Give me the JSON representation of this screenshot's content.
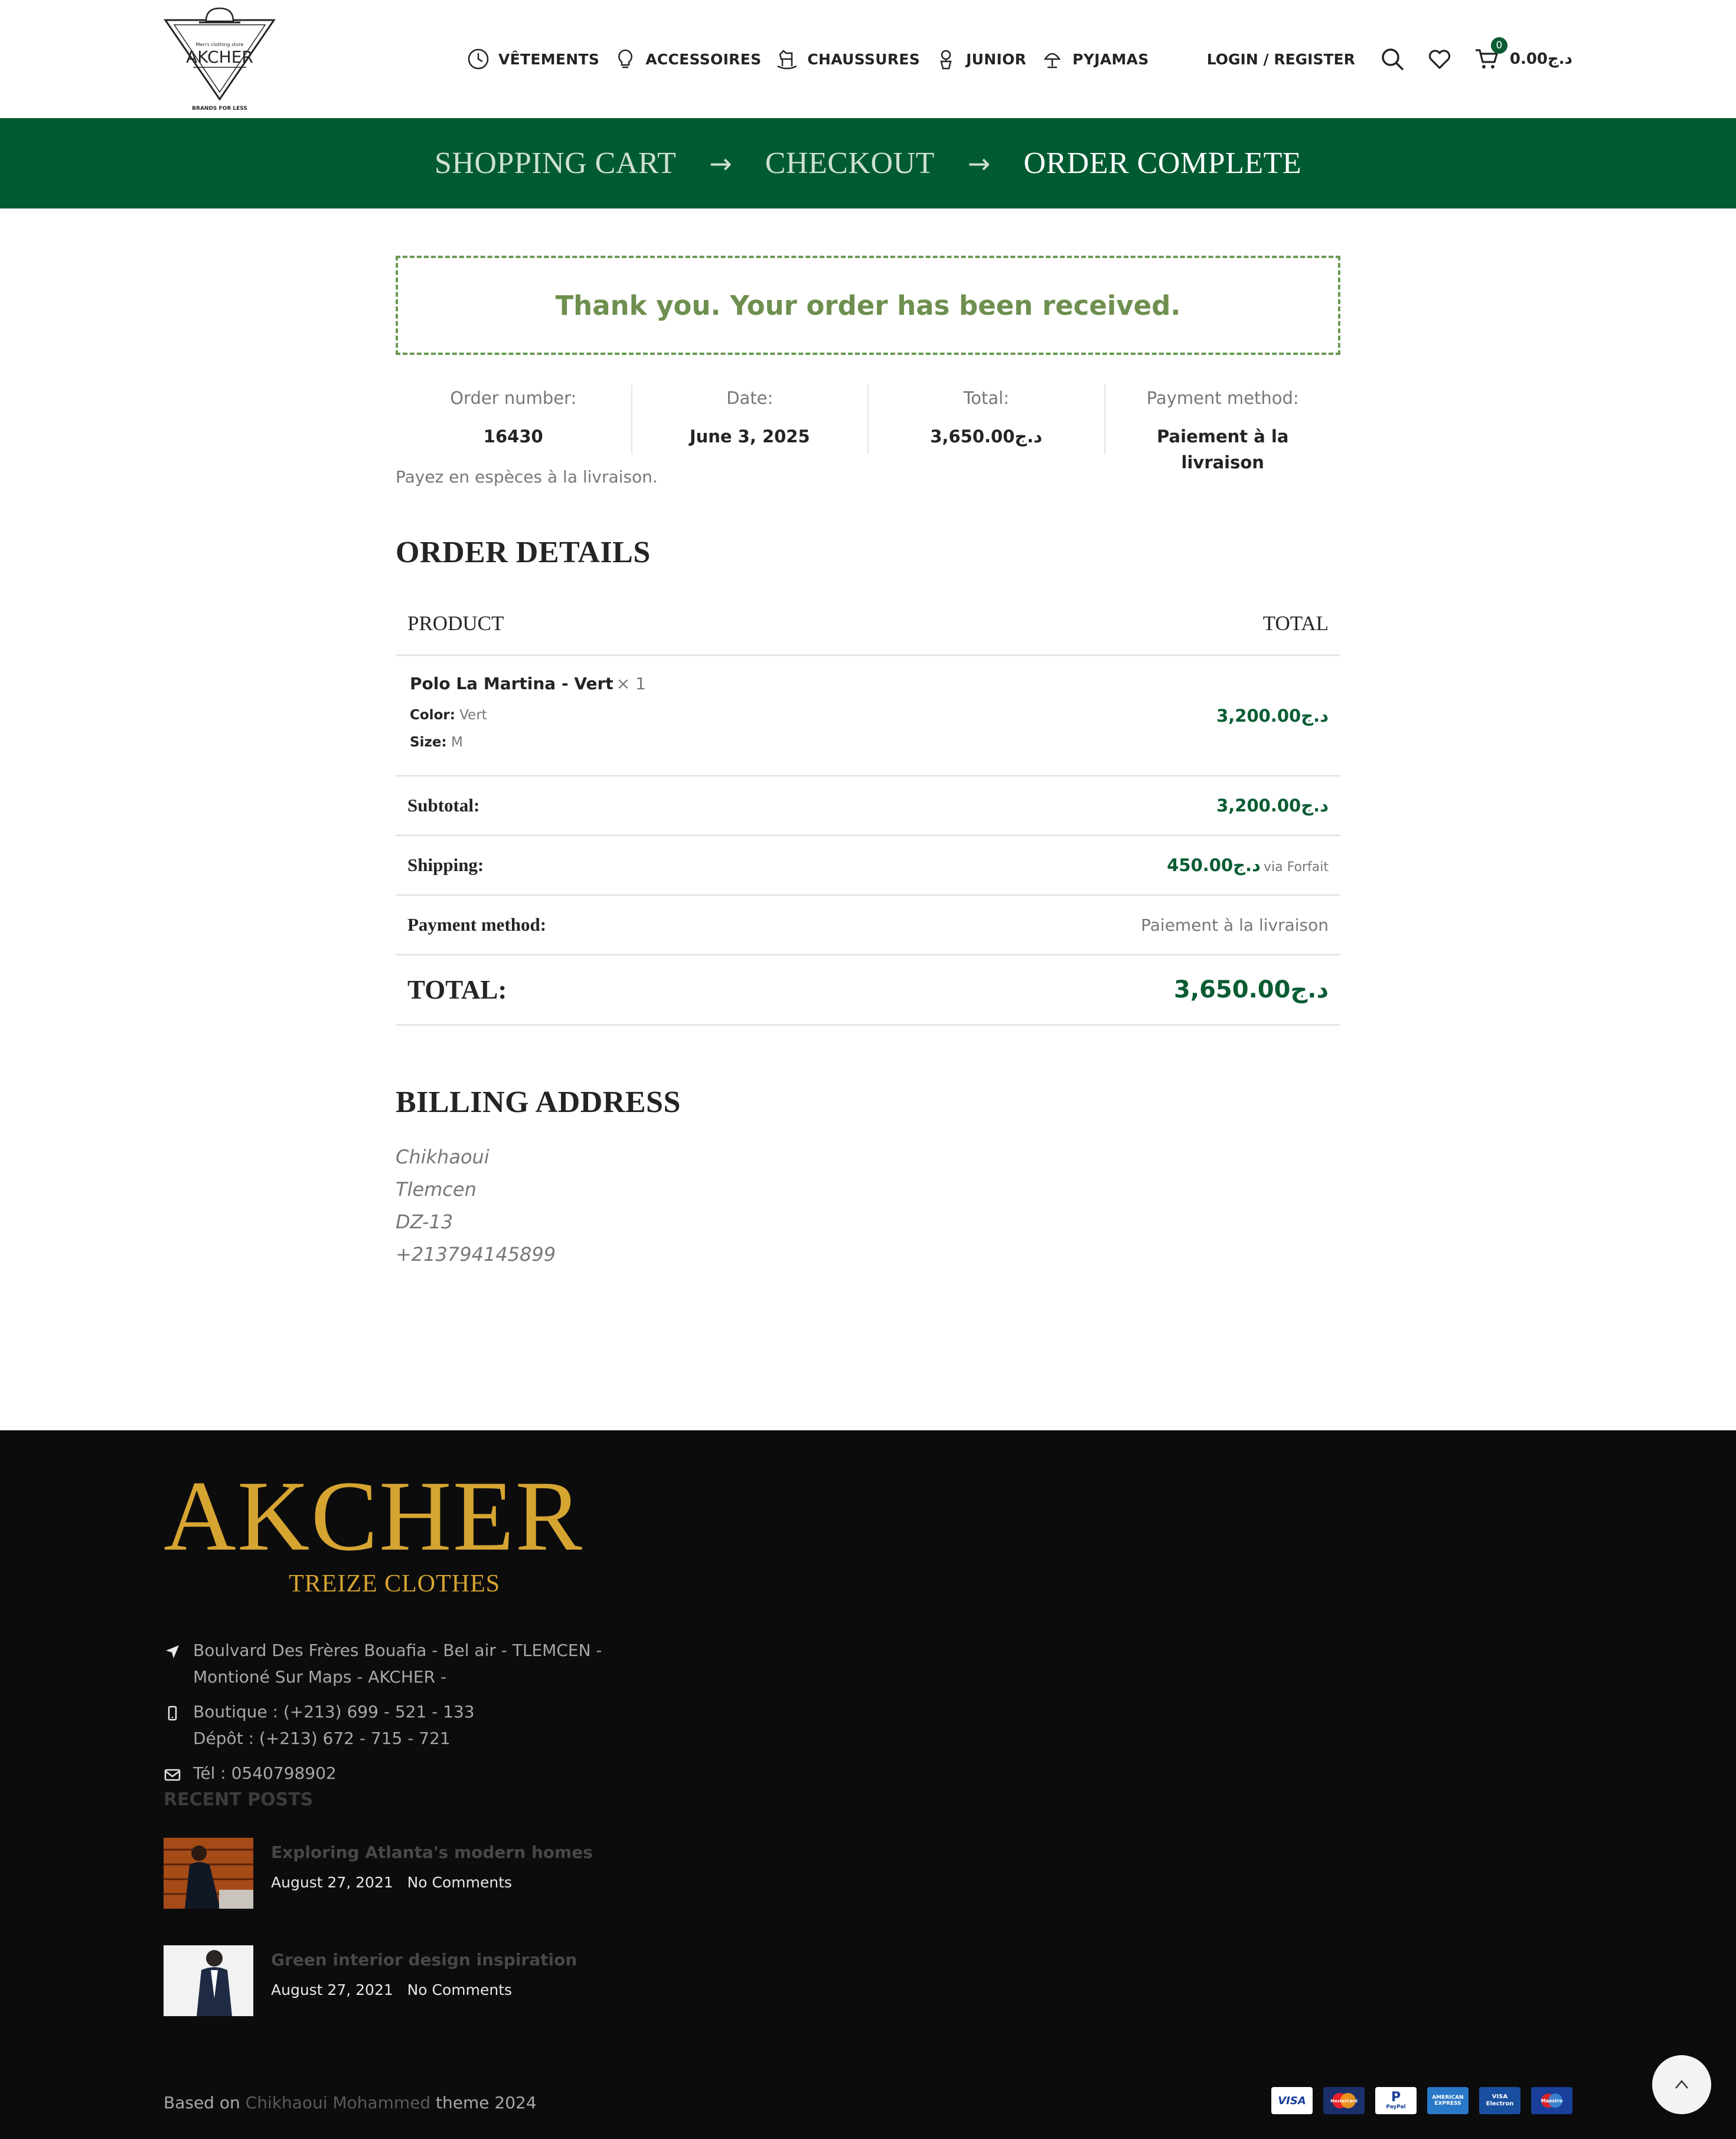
{
  "header": {
    "logo": {
      "tagline": "Men's clothing store",
      "name": "AKCHER",
      "subtitle": "BRANDS FOR LESS"
    },
    "nav": [
      {
        "label": "VÊTEMENTS",
        "icon": "clock-icon"
      },
      {
        "label": "ACCESSOIRES",
        "icon": "lightbulb-icon"
      },
      {
        "label": "CHAUSSURES",
        "icon": "rocking-horse-icon"
      },
      {
        "label": "JUNIOR",
        "icon": "plant-icon"
      },
      {
        "label": "PYJAMAS",
        "icon": "lamp-icon"
      }
    ],
    "login_label": "LOGIN / REGISTER",
    "cart_count": "0",
    "cart_total": "0.00د.ج"
  },
  "steps": {
    "cart": "SHOPPING CART",
    "checkout": "CHECKOUT",
    "complete": "ORDER COMPLETE",
    "arrow": "→"
  },
  "notice": "Thank you. Your order has been received.",
  "overview": [
    {
      "label": "Order number:",
      "value": "16430"
    },
    {
      "label": "Date:",
      "value": "June 3, 2025"
    },
    {
      "label": "Total:",
      "value": "3,650.00د.ج"
    },
    {
      "label": "Payment method:",
      "value": "Paiement à la livraison"
    }
  ],
  "payment_note": "Payez en espèces à la livraison.",
  "order_details": {
    "title": "ORDER DETAILS",
    "col_product": "PRODUCT",
    "col_total": "TOTAL",
    "item": {
      "name": "Polo La Martina - Vert",
      "qty": "× 1",
      "color_label": "Color:",
      "color": "Vert",
      "size_label": "Size:",
      "size": "M",
      "total": "3,200.00د.ج"
    },
    "subtotal_label": "Subtotal:",
    "subtotal": "3,200.00د.ج",
    "shipping_label": "Shipping:",
    "shipping": "450.00د.ج",
    "shipping_via": "via Forfait",
    "payment_label": "Payment method:",
    "payment": "Paiement à la livraison",
    "total_label": "TOTAL:",
    "total": "3,650.00د.ج"
  },
  "billing": {
    "title": "BILLING ADDRESS",
    "lines": [
      "Chikhaoui",
      "Tlemcen",
      "DZ-13",
      "+213794145899"
    ]
  },
  "footer": {
    "logo_big": "AKCHER",
    "logo_small": "TREIZE CLOTHES",
    "address": [
      "Boulvard Des Frères Bouafia - Bel air - TLEMCEN -",
      "Montioné Sur Maps - AKCHER -"
    ],
    "phones": [
      "Boutique : (+213) 699 - 521 - 133",
      "Dépôt : (+213) 672 - 715 - 721"
    ],
    "tel": "Tél : 0540798902",
    "recent_title": "RECENT POSTS",
    "posts": [
      {
        "title": "Exploring Atlanta's modern homes",
        "date": "August 27, 2021",
        "comments": "No Comments"
      },
      {
        "title": "Green interior design inspiration",
        "date": "August 27, 2021",
        "comments": "No Comments"
      }
    ],
    "credit_prefix": "Based on ",
    "credit_link": "Chikhaoui Mohammed",
    "credit_suffix": " theme 2024",
    "payments": [
      "VISA",
      "MasterCard",
      "PayPal",
      "AMERICAN EXPRESS",
      "VISA Electron",
      "Maestro"
    ]
  },
  "colors": {
    "brand_green": "#005b32",
    "price_green": "#0a5c33",
    "notice_green": "#6e8f4f",
    "gold": "#d6a431",
    "footer_bg": "#0c0c0d"
  }
}
